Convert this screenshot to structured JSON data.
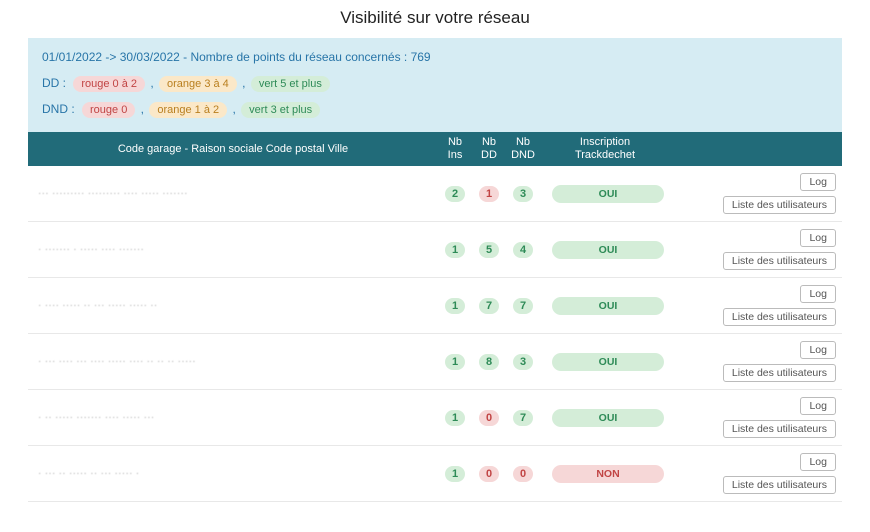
{
  "title": "Visibilité sur votre réseau",
  "info": {
    "period_line": "01/01/2022 -> 30/03/2022 - Nombre de points du réseau concernés : 769",
    "dd_label": "DD :",
    "dnd_label": "DND :",
    "dd_legend": {
      "red": "rouge 0 à 2",
      "orange": "orange 3 à 4",
      "green": "vert 5 et plus"
    },
    "dnd_legend": {
      "red": "rouge 0",
      "orange": "orange 1 à 2",
      "green": "vert 3 et plus"
    },
    "sep": ","
  },
  "headers": {
    "name": "Code garage - Raison sociale Code postal Ville",
    "ins": "Nb Ins",
    "dd": "Nb DD",
    "dnd": "Nb DND",
    "inscription": "Inscription Trackdechet"
  },
  "buttons": {
    "log": "Log",
    "users": "Liste des utilisateurs"
  },
  "inscription_labels": {
    "oui": "OUI",
    "non": "NON"
  },
  "rows": [
    {
      "name": "··· ········· ········· ···· ····· ·······",
      "ins": {
        "v": "2",
        "c": "green"
      },
      "dd": {
        "v": "1",
        "c": "red"
      },
      "dnd": {
        "v": "3",
        "c": "green"
      },
      "insc": "oui"
    },
    {
      "name": "· ······· · ····· ···· ·······",
      "ins": {
        "v": "1",
        "c": "green"
      },
      "dd": {
        "v": "5",
        "c": "green"
      },
      "dnd": {
        "v": "4",
        "c": "green"
      },
      "insc": "oui"
    },
    {
      "name": "· ···· ····· ·· ··· ····· ····· ··",
      "ins": {
        "v": "1",
        "c": "green"
      },
      "dd": {
        "v": "7",
        "c": "green"
      },
      "dnd": {
        "v": "7",
        "c": "green"
      },
      "insc": "oui"
    },
    {
      "name": "·  ··· ···· ··· ···· ····· ···· ·· ·· ·· ·····",
      "ins": {
        "v": "1",
        "c": "green"
      },
      "dd": {
        "v": "8",
        "c": "green"
      },
      "dnd": {
        "v": "3",
        "c": "green"
      },
      "insc": "oui"
    },
    {
      "name": "·  ·· ····· ······· ···· ····· ···",
      "ins": {
        "v": "1",
        "c": "green"
      },
      "dd": {
        "v": "0",
        "c": "red"
      },
      "dnd": {
        "v": "7",
        "c": "green"
      },
      "insc": "oui"
    },
    {
      "name": "·  ··· ·· ····· ·· ··· ····· ·",
      "ins": {
        "v": "1",
        "c": "green"
      },
      "dd": {
        "v": "0",
        "c": "red"
      },
      "dnd": {
        "v": "0",
        "c": "red"
      },
      "insc": "non"
    }
  ]
}
